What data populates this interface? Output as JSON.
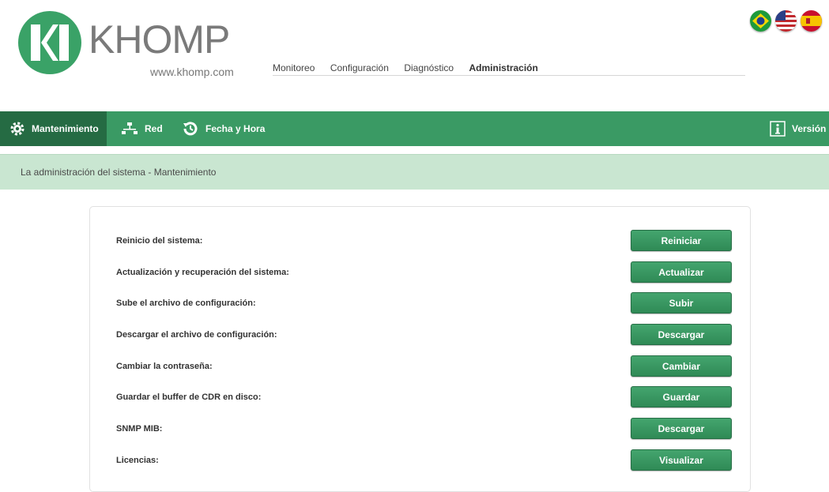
{
  "header": {
    "brand": "KHOMP",
    "site": "www.khomp.com",
    "logo_icon": "khomp-logo-icon"
  },
  "topnav": [
    {
      "label": "Monitoreo",
      "active": false
    },
    {
      "label": "Configuración",
      "active": false
    },
    {
      "label": "Diagnóstico",
      "active": false
    },
    {
      "label": "Administración",
      "active": true
    }
  ],
  "flags": [
    "brazil-flag-icon",
    "usa-flag-icon",
    "spain-flag-icon"
  ],
  "menubar": {
    "items": [
      {
        "label": "Mantenimiento",
        "icon": "gear-icon",
        "active": true
      },
      {
        "label": "Red",
        "icon": "network-icon",
        "active": false
      },
      {
        "label": "Fecha y Hora",
        "icon": "clock-history-icon",
        "active": false
      }
    ],
    "right_item": {
      "label": "Versión",
      "icon": "info-icon"
    }
  },
  "breadcrumb": "La administración del sistema - Mantenimiento",
  "rows": [
    {
      "label": "Reinicio del sistema:",
      "button": "Reiniciar"
    },
    {
      "label": "Actualización y recuperación del sistema:",
      "button": "Actualizar"
    },
    {
      "label": "Sube el archivo de configuración:",
      "button": "Subir"
    },
    {
      "label": "Descargar el archivo de configuración:",
      "button": "Descargar"
    },
    {
      "label": "Cambiar la contraseña:",
      "button": "Cambiar"
    },
    {
      "label": "Guardar el buffer de CDR en disco:",
      "button": "Guardar"
    },
    {
      "label": "SNMP MIB:",
      "button": "Descargar"
    },
    {
      "label": "Licencias:",
      "button": "Visualizar"
    }
  ],
  "colors": {
    "menubar": "#3a9a64",
    "menubar_active": "#256b43",
    "breadcrumb_bg": "#c9e6d1",
    "button": "#389a62"
  }
}
